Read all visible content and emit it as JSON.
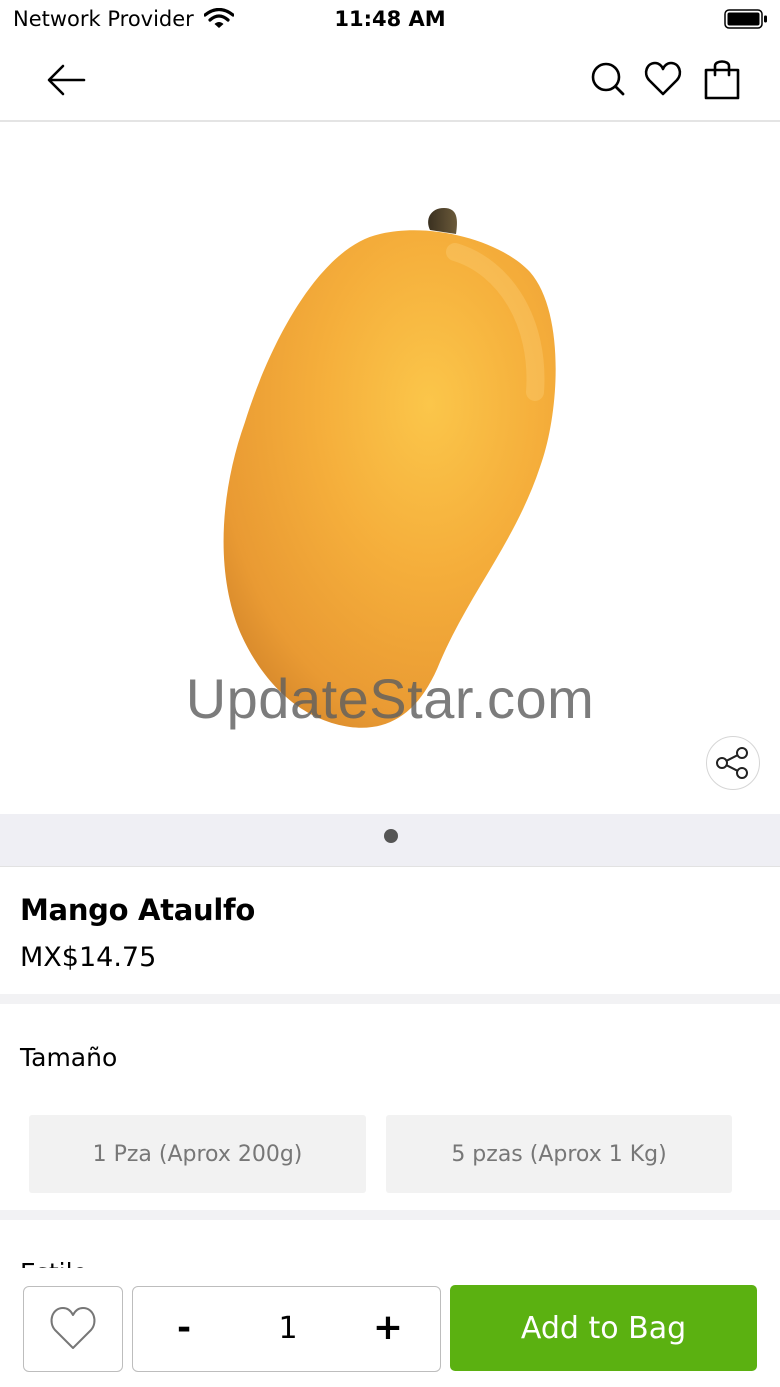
{
  "status_bar": {
    "carrier": "Network Provider",
    "time": "11:48 AM"
  },
  "nav": {
    "back_icon": "arrow-left-icon",
    "search_icon": "search-icon",
    "wishlist_icon": "heart-icon",
    "bag_icon": "shopping-bag-icon"
  },
  "product": {
    "watermark": "UpdateStar.com",
    "name": "Mango Ataulfo",
    "price": "MX$14.75",
    "image_pages": 1,
    "current_page": 1
  },
  "size": {
    "label": "Tamaño",
    "options": [
      {
        "label": "1 Pza (Aprox 200g)"
      },
      {
        "label": "5 pzas (Aprox 1 Kg)"
      }
    ]
  },
  "next_section": {
    "label": "Estilo"
  },
  "bottom_bar": {
    "quantity": "1",
    "minus": "-",
    "plus": "+",
    "add_label": "Add to Bag"
  },
  "colors": {
    "accent": "#5bb111",
    "pager_bg": "#efeff4"
  }
}
